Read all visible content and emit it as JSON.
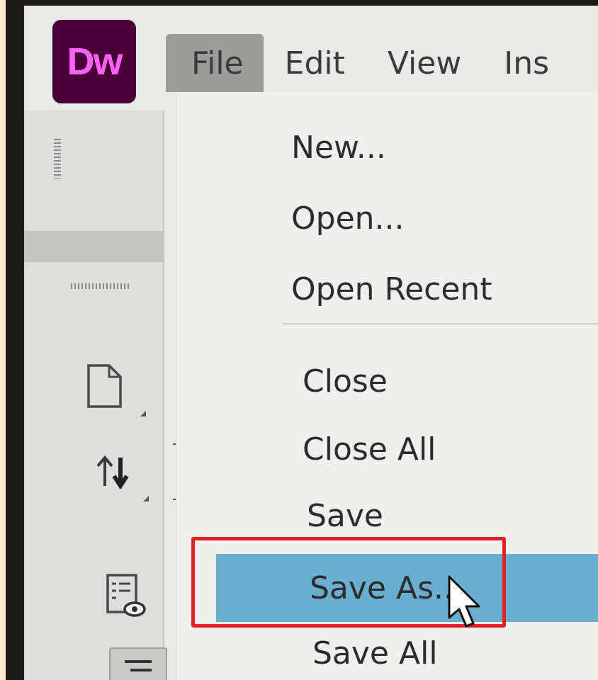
{
  "app": {
    "logo_text": "Dw",
    "logo_bg": "#470137",
    "logo_fg": "#ff61f6"
  },
  "menubar": [
    {
      "label": "File",
      "open": true
    },
    {
      "label": "Edit"
    },
    {
      "label": "View"
    },
    {
      "label": "Ins"
    }
  ],
  "file_menu": {
    "items": [
      {
        "label": "New..."
      },
      {
        "label": "Open..."
      },
      {
        "label": "Open Recent"
      },
      {
        "label": "Close"
      },
      {
        "label": "Close All"
      },
      {
        "label": "Save"
      },
      {
        "label": "Save As...",
        "selected": true
      },
      {
        "label": "Save All"
      }
    ],
    "selection_color": "#6aaed0"
  },
  "left_panel": {
    "icons": [
      "new-document-icon",
      "sort-arrows-icon",
      "live-view-inspect-icon"
    ]
  },
  "annotation": {
    "highlight_color": "#e32227",
    "target": "Save As..."
  }
}
